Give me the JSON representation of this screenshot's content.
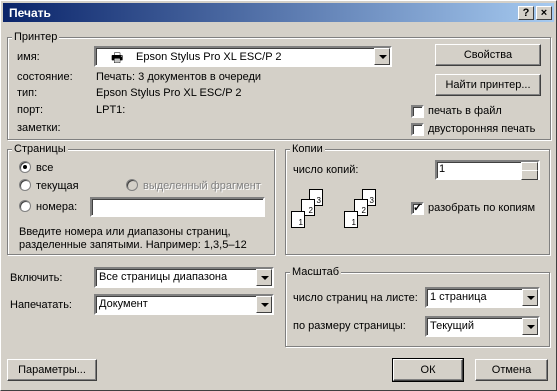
{
  "window": {
    "title": "Печать"
  },
  "printer": {
    "group": "Принтер",
    "name_label": "имя:",
    "name_value": "Epson Stylus Pro XL ESC/P 2",
    "status_label": "состояние:",
    "status_value": "Печать: 3 документов в очереди",
    "type_label": "тип:",
    "type_value": "Epson Stylus Pro XL ESC/P 2",
    "port_label": "порт:",
    "port_value": "LPT1:",
    "notes_label": "заметки:",
    "properties": "Свойства",
    "find": "Найти принтер...",
    "print_to_file": "печать в файл",
    "duplex": "двусторонняя печать"
  },
  "pages": {
    "group": "Страницы",
    "all": "все",
    "current": "текущая",
    "selection": "выделенный фрагмент",
    "numbers": "номера:",
    "hint1": "Введите номера или диапазоны страниц,",
    "hint2": "разделенные запятыми. Например: 1,3,5–12"
  },
  "copies": {
    "group": "Копии",
    "count_label": "число копий:",
    "count_value": "1",
    "collate": "разобрать по копиям"
  },
  "include": {
    "label": "Включить:",
    "value": "Все страницы диапазона"
  },
  "print_what": {
    "label": "Напечатать:",
    "value": "Документ"
  },
  "zoom": {
    "group": "Масштаб",
    "pps_label": "число страниц на листе:",
    "pps_value": "1 страница",
    "scale_label": "по размеру страницы:",
    "scale_value": "Текущий"
  },
  "buttons": {
    "options": "Параметры...",
    "ok": "ОК",
    "cancel": "Отмена"
  },
  "titlebar": {
    "help": "?",
    "close": "×"
  }
}
